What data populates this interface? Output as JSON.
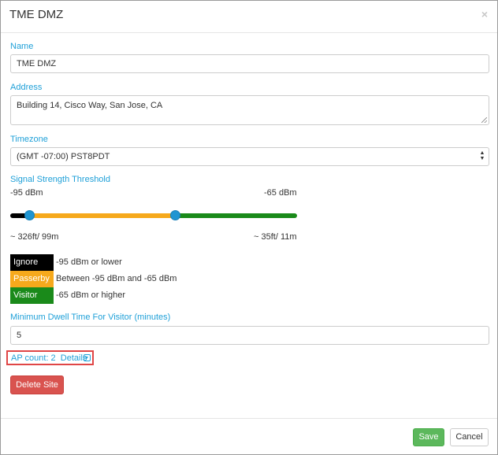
{
  "modal": {
    "title": "TME DMZ",
    "close_glyph": "×"
  },
  "form": {
    "name_label": "Name",
    "name_value": "TME DMZ",
    "address_label": "Address",
    "address_value": "Building 14, Cisco Way, San Jose, CA",
    "timezone_label": "Timezone",
    "timezone_value": "(GMT -07:00) PST8PDT",
    "signal_label": "Signal Strength Threshold",
    "signal_min_dbm": "-95 dBm",
    "signal_max_dbm": "-65 dBm",
    "signal_min_distance": "~ 326ft/ 99m",
    "signal_max_distance": "~ 35ft/ 11m",
    "slider_low_fraction": 0.066,
    "slider_high_fraction": 0.575,
    "dwell_label": "Minimum Dwell Time For Visitor (minutes)",
    "dwell_value": "5"
  },
  "legend": [
    {
      "name": "Ignore",
      "desc": "-95 dBm or lower",
      "color": "#000000"
    },
    {
      "name": "Passerby",
      "desc": "Between -95 dBm and -65 dBm",
      "color": "#f6a91c"
    },
    {
      "name": "Visitor",
      "desc": "-65 dBm or higher",
      "color": "#1a8a1a"
    }
  ],
  "ap": {
    "count_text": "AP count: 2",
    "details_label": "Details"
  },
  "buttons": {
    "delete_site": "Delete Site",
    "save": "Save",
    "cancel": "Cancel"
  },
  "colors": {
    "accent": "#1fa0d8",
    "danger": "#d9534f",
    "success": "#5cb85c",
    "handle": "#1f95d2"
  }
}
